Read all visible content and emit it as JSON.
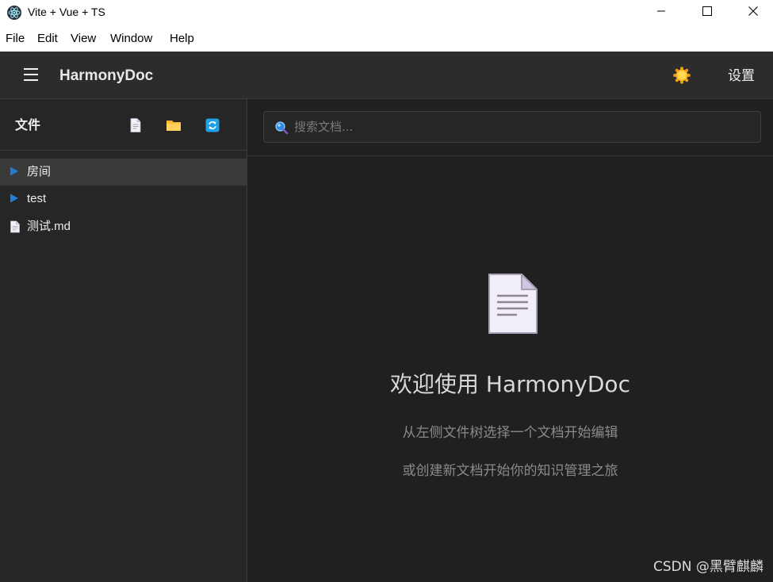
{
  "window": {
    "title": "Vite + Vue + TS"
  },
  "menubar": {
    "items": [
      "File",
      "Edit",
      "View",
      "Window",
      "Help"
    ]
  },
  "header": {
    "brand": "HarmonyDoc",
    "settings_label": "设置",
    "theme_icon": "sun-icon"
  },
  "sidebar": {
    "title": "文件",
    "actions": [
      "new-file-icon",
      "new-folder-icon",
      "refresh-icon"
    ],
    "tree": [
      {
        "label": "房间",
        "type": "folder",
        "selected": true
      },
      {
        "label": "test",
        "type": "folder",
        "selected": false
      },
      {
        "label": "测试.md",
        "type": "file",
        "selected": false
      }
    ]
  },
  "search": {
    "placeholder": "搜索文档..."
  },
  "welcome": {
    "title": "欢迎使用 HarmonyDoc",
    "line1": "从左侧文件树选择一个文档开始编辑",
    "line2": "或创建新文档开始你的知识管理之旅"
  },
  "watermark": "CSDN @黑臂麒麟",
  "colors": {
    "accent": "#1f7fd6",
    "folder": "#f5b82e",
    "background": "#202020",
    "sidebar": "#262626",
    "header": "#2c2c2c"
  }
}
